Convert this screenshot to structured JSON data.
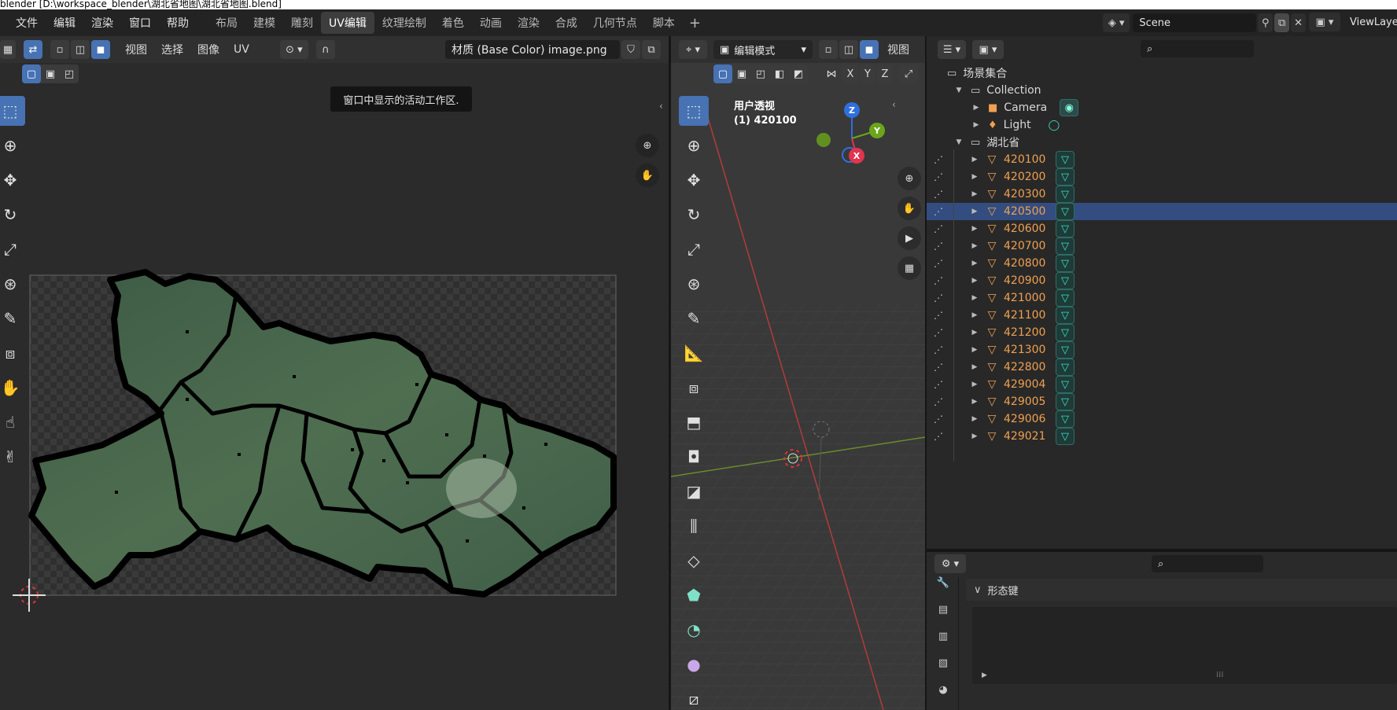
{
  "window": {
    "title": "blender [D:\\workspace_blender\\湖北省地图\\湖北省地图.blend]"
  },
  "menu": [
    "文件",
    "编辑",
    "渲染",
    "窗口",
    "帮助"
  ],
  "workspaces": [
    "布局",
    "建模",
    "雕刻",
    "UV编辑",
    "纹理绘制",
    "着色",
    "动画",
    "渲染",
    "合成",
    "几何节点",
    "脚本"
  ],
  "active_workspace": "UV编辑",
  "scene": {
    "name": "Scene",
    "view_layer": "ViewLayer"
  },
  "uv_editor": {
    "menus": [
      "视图",
      "选择",
      "图像",
      "UV"
    ],
    "image_name": "材质 (Base Color) image.png",
    "tooltip": "窗口中显示的活动工作区."
  },
  "viewport": {
    "mode": "编辑模式",
    "view_menu": "视图",
    "axes": [
      "X",
      "Y",
      "Z"
    ],
    "overlay_title": "用户透视",
    "overlay_object": "(1) 420100",
    "gizmo": {
      "x": "X",
      "y": "Y",
      "z": "Z"
    }
  },
  "outliner": {
    "scene_collection": "场景集合",
    "collection": "Collection",
    "objects_top": [
      "Camera",
      "Light"
    ],
    "group": "湖北省",
    "items": [
      "420100",
      "420200",
      "420300",
      "420500",
      "420600",
      "420700",
      "420800",
      "420900",
      "421000",
      "421100",
      "421200",
      "421300",
      "422800",
      "429004",
      "429005",
      "429006",
      "429021"
    ],
    "selected": "420500"
  },
  "properties": {
    "panel_title": "形态键"
  },
  "colors": {
    "accent_blue": "#4772b3",
    "selection_row": "#334d80",
    "mesh_orange": "#f0a050",
    "modifier_green": "#3ae0c6"
  }
}
